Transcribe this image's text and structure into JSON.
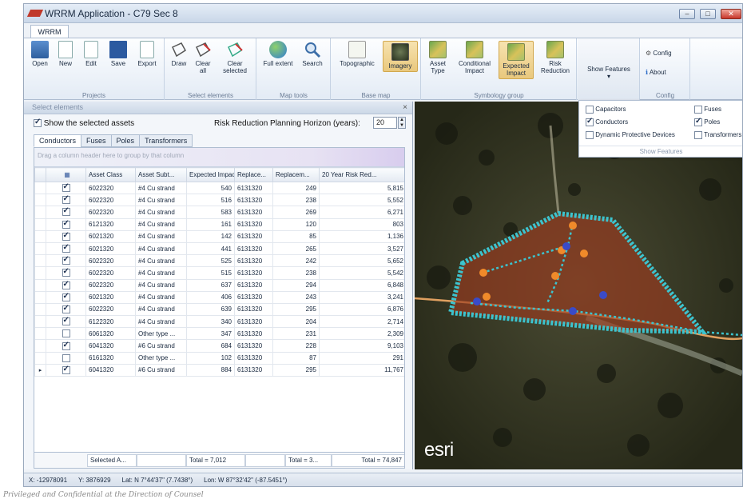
{
  "window": {
    "title": "WRRM Application - C79 Sec 8"
  },
  "ribbon": {
    "tab": "WRRM",
    "groups": {
      "projects": {
        "label": "Projects",
        "open": "Open",
        "new": "New",
        "edit": "Edit",
        "save": "Save",
        "export": "Export"
      },
      "select": {
        "label": "Select elements",
        "draw": "Draw",
        "clear_all": "Clear all",
        "clear_selected": "Clear selected"
      },
      "map_tools": {
        "label": "Map tools",
        "full_extent": "Full extent",
        "search": "Search"
      },
      "base_map": {
        "label": "Base map",
        "topographic": "Topographic",
        "imagery": "Imagery"
      },
      "symbology": {
        "label": "Symbology group",
        "asset_type": "Asset Type",
        "conditional_impact": "Conditional Impact",
        "expected_impact": "Expected Impact",
        "risk_reduction": "Risk Reduction"
      },
      "show_features": {
        "label": "Show Features"
      },
      "config": {
        "label": "Config",
        "config": "Config",
        "about": "About"
      }
    }
  },
  "panel": {
    "title": "Select elements",
    "show_selected": "Show the selected assets",
    "horizon_label": "Risk Reduction Planning Horizon (years):",
    "horizon_value": "20",
    "tabs": [
      "Conductors",
      "Fuses",
      "Poles",
      "Transformers"
    ],
    "group_hint": "Drag a column header here to group by that column",
    "columns": [
      "Asset Class",
      "Asset Subt...",
      "Expected Impact",
      "Replace...",
      "Replacem...",
      "20 Year Risk Red..."
    ],
    "rows": [
      {
        "checked": true,
        "asset_class": "6022320",
        "subtype": "#4 Cu strand",
        "expected": "540",
        "replace": "6131320",
        "replacem": "249",
        "risk": "5,815"
      },
      {
        "checked": true,
        "asset_class": "6022320",
        "subtype": "#4 Cu strand",
        "expected": "516",
        "replace": "6131320",
        "replacem": "238",
        "risk": "5,552"
      },
      {
        "checked": true,
        "asset_class": "6022320",
        "subtype": "#4 Cu strand",
        "expected": "583",
        "replace": "6131320",
        "replacem": "269",
        "risk": "6,271"
      },
      {
        "checked": true,
        "asset_class": "6121320",
        "subtype": "#4 Cu strand",
        "expected": "161",
        "replace": "6131320",
        "replacem": "120",
        "risk": "803"
      },
      {
        "checked": true,
        "asset_class": "6021320",
        "subtype": "#4 Cu strand",
        "expected": "142",
        "replace": "6131320",
        "replacem": "85",
        "risk": "1,136"
      },
      {
        "checked": true,
        "asset_class": "6021320",
        "subtype": "#4 Cu strand",
        "expected": "441",
        "replace": "6131320",
        "replacem": "265",
        "risk": "3,527"
      },
      {
        "checked": true,
        "asset_class": "6022320",
        "subtype": "#4 Cu strand",
        "expected": "525",
        "replace": "6131320",
        "replacem": "242",
        "risk": "5,652"
      },
      {
        "checked": true,
        "asset_class": "6022320",
        "subtype": "#4 Cu strand",
        "expected": "515",
        "replace": "6131320",
        "replacem": "238",
        "risk": "5,542"
      },
      {
        "checked": true,
        "asset_class": "6022320",
        "subtype": "#4 Cu strand",
        "expected": "637",
        "replace": "6131320",
        "replacem": "294",
        "risk": "6,848"
      },
      {
        "checked": true,
        "asset_class": "6021320",
        "subtype": "#4 Cu strand",
        "expected": "406",
        "replace": "6131320",
        "replacem": "243",
        "risk": "3,241"
      },
      {
        "checked": true,
        "asset_class": "6022320",
        "subtype": "#4 Cu strand",
        "expected": "639",
        "replace": "6131320",
        "replacem": "295",
        "risk": "6,876"
      },
      {
        "checked": true,
        "asset_class": "6122320",
        "subtype": "#4 Cu strand",
        "expected": "340",
        "replace": "6131320",
        "replacem": "204",
        "risk": "2,714"
      },
      {
        "checked": false,
        "asset_class": "6061320",
        "subtype": "Other type ...",
        "expected": "347",
        "replace": "6131320",
        "replacem": "231",
        "risk": "2,309"
      },
      {
        "checked": true,
        "asset_class": "6041320",
        "subtype": "#6 Cu strand",
        "expected": "684",
        "replace": "6131320",
        "replacem": "228",
        "risk": "9,103"
      },
      {
        "checked": false,
        "asset_class": "6161320",
        "subtype": "Other type ...",
        "expected": "102",
        "replace": "6131320",
        "replacem": "87",
        "risk": "291"
      },
      {
        "checked": true,
        "asset_class": "6041320",
        "subtype": "#6 Cu strand",
        "expected": "884",
        "replace": "6131320",
        "replacem": "295",
        "risk": "11,767"
      }
    ],
    "footer": {
      "selected": "Selected A...",
      "total_expected": "Total = 7,012",
      "total_replacem": "Total = 3...",
      "total_risk": "Total = 74,847"
    }
  },
  "features": {
    "label": "Show Features",
    "items": [
      {
        "name": "Capacitors",
        "checked": false
      },
      {
        "name": "Conductors",
        "checked": true
      },
      {
        "name": "Dynamic Protective Devices",
        "checked": false
      },
      {
        "name": "Fuses",
        "checked": false
      },
      {
        "name": "Poles",
        "checked": true
      },
      {
        "name": "Transformers",
        "checked": false
      }
    ]
  },
  "map": {
    "logo": "esri"
  },
  "status": {
    "x": "X: -12978091",
    "y": "Y: 3876929",
    "lat": "Lat: N 7°44'37\" (7.7438°)",
    "lon": "Lon: W 87°32'42\" (-87.5451°)"
  },
  "footer_note": "Privileged and Confidential at the Direction of Counsel",
  "colors": {
    "polygon": "#3cc4cf",
    "fill": "#9b3a1e",
    "pole_orange": "#f08a2a",
    "pole_blue": "#3a4bc8",
    "road": "#e0a060"
  }
}
